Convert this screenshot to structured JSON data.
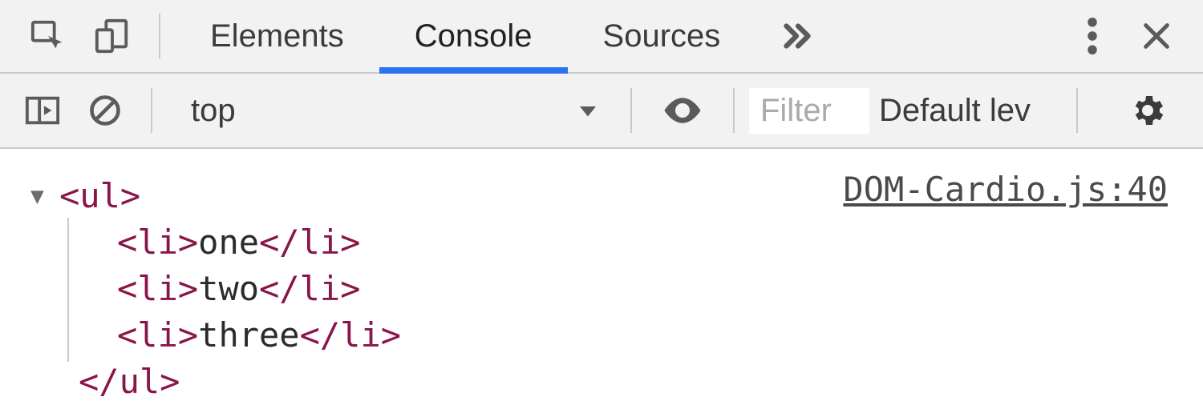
{
  "toolbar": {
    "tabs": {
      "elements": "Elements",
      "console": "Console",
      "sources": "Sources"
    }
  },
  "consoleBar": {
    "context": "top",
    "filterPlaceholder": "Filter",
    "levels": "Default lev"
  },
  "output": {
    "sourceLink": "DOM-Cardio.js:40",
    "ulOpen": "<ul>",
    "ulClose": "</ul>",
    "items": [
      {
        "open": "<li>",
        "text": "one",
        "close": "</li>"
      },
      {
        "open": "<li>",
        "text": "two",
        "close": "</li>"
      },
      {
        "open": "<li>",
        "text": "three",
        "close": "</li>"
      }
    ]
  }
}
